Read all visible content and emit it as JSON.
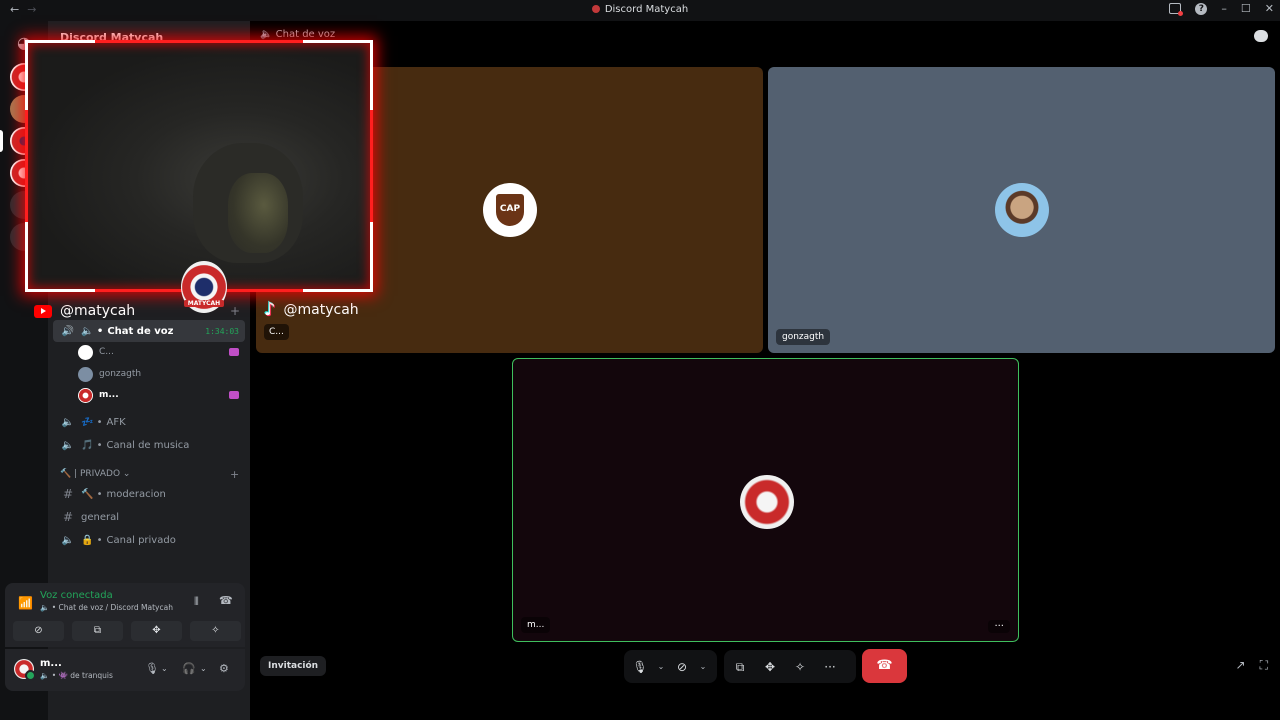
{
  "window": {
    "title": "Discord Matycah",
    "back": "←",
    "forward": "→",
    "help": "?",
    "minimize": "–",
    "maximize": "☐",
    "close": "✕"
  },
  "server": {
    "name": "Discord Matycah",
    "header_channel": "Chat de voz"
  },
  "sidebar": {
    "youtube_handle": "@matycah",
    "channels": [
      {
        "icon": "speaker-icon",
        "prefix": "🔈 •",
        "name": "Chat de voz",
        "timer": "1:34:03",
        "active": true
      },
      {
        "icon": "speaker-icon",
        "prefix": "💤 •",
        "name": "AFK"
      },
      {
        "icon": "speaker-icon",
        "prefix": "🎵 •",
        "name": "Canal de musica"
      }
    ],
    "voice_users": [
      {
        "name": "C...",
        "activity": true
      },
      {
        "name": "gonzagth",
        "activity": false
      },
      {
        "name": "m...",
        "activity": true
      }
    ],
    "category": "🔨 | PRIVADO ⌄",
    "private_channels": [
      {
        "type": "text",
        "prefix": "🔨 •",
        "name": "moderacion"
      },
      {
        "type": "text",
        "prefix": "",
        "name": "general"
      },
      {
        "type": "voice",
        "prefix": "🔒 •",
        "name": "Canal privado"
      }
    ]
  },
  "voice_panel": {
    "status": "Voz conectada",
    "location": "🔈 • Chat de voz / Discord Matycah"
  },
  "user_panel": {
    "name": "m...",
    "status": "🔈 • 👾 de tranquis"
  },
  "stage": {
    "overlay_handle": "@matycah",
    "tiles": [
      {
        "label": "C...",
        "avatar_text": "CAP",
        "color": "#472b10"
      },
      {
        "label": "gonzagth",
        "color": "#536070"
      },
      {
        "label": "m...",
        "color": "#13060c",
        "speaking": true,
        "more": "···"
      }
    ],
    "cam_badge": "MATYCAH"
  },
  "controls": {
    "invite_label": "Invitación",
    "more": "···"
  },
  "colors": {
    "accent_green": "#23a55a",
    "hangup_red": "#da373c",
    "overlay_red": "#ff1f1f"
  }
}
